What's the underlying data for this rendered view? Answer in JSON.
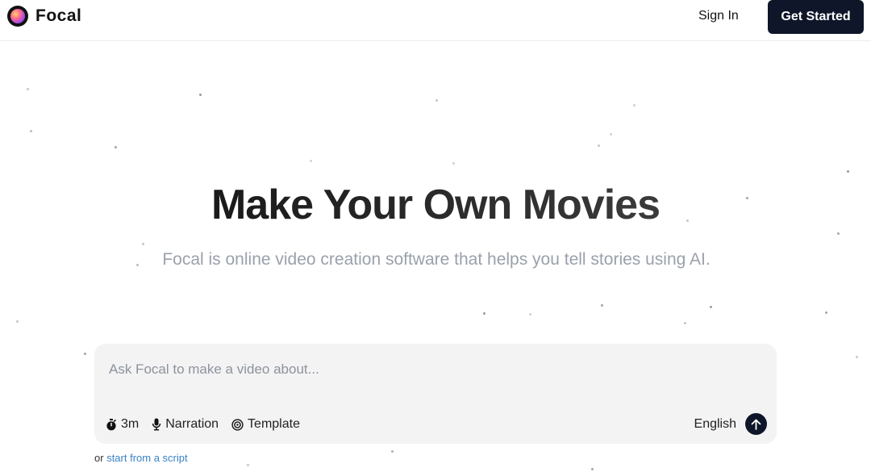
{
  "header": {
    "brand_name": "Focal",
    "sign_in_label": "Sign In",
    "get_started_label": "Get Started"
  },
  "hero": {
    "title": "Make Your Own Movies",
    "subtitle": "Focal is online video creation software that helps you tell stories using AI."
  },
  "prompt": {
    "placeholder": "Ask Focal to make a video about...",
    "value": "",
    "options": {
      "duration_label": "3m",
      "narration_label": "Narration",
      "template_label": "Template"
    },
    "language_label": "English"
  },
  "footer_line": {
    "prefix": "or",
    "link_label": "start from a script"
  },
  "colors": {
    "accent_dark": "#0f1629",
    "subtitle_gray": "#9aa1ab",
    "link_blue": "#3b82c4",
    "prompt_bg": "#f3f3f4"
  },
  "icons": {
    "logo": "focal-logo",
    "duration": "stopwatch-icon",
    "narration": "microphone-icon",
    "template": "target-icon",
    "send": "arrow-up-icon"
  }
}
